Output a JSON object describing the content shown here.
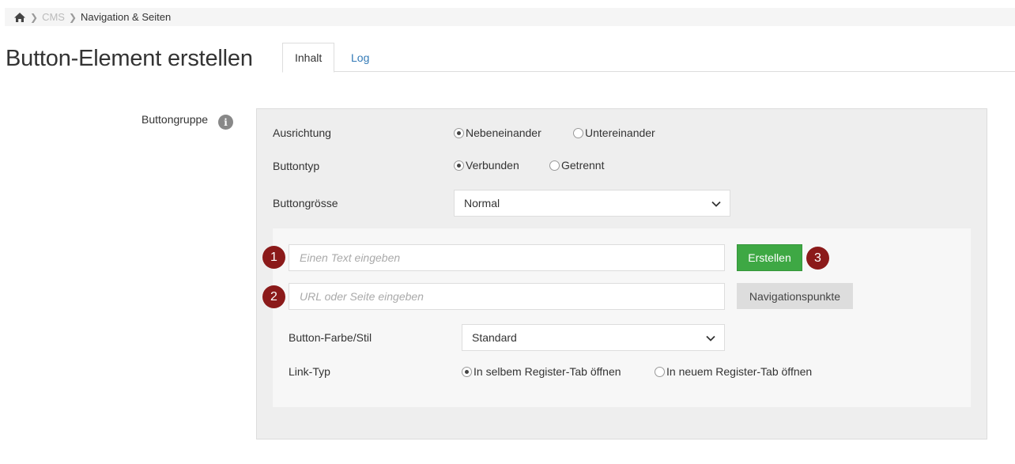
{
  "breadcrumb": {
    "home_icon": "home-icon",
    "items": [
      "CMS",
      "Navigation & Seiten"
    ]
  },
  "page": {
    "title": "Button-Element erstellen"
  },
  "tabs": [
    {
      "label": "Inhalt",
      "active": true
    },
    {
      "label": "Log",
      "active": false
    }
  ],
  "group": {
    "label": "Buttongruppe",
    "info_icon": "info-icon"
  },
  "ausrichtung": {
    "label": "Ausrichtung",
    "options": [
      "Nebeneinander",
      "Untereinander"
    ],
    "selected": "Nebeneinander"
  },
  "buttontyp": {
    "label": "Buttontyp",
    "options": [
      "Verbunden",
      "Getrennt"
    ],
    "selected": "Verbunden"
  },
  "buttongroesse": {
    "label": "Buttongrösse",
    "value": "Normal"
  },
  "button_editor": {
    "text_placeholder": "Einen Text eingeben",
    "url_placeholder": "URL oder Seite eingeben",
    "create_label": "Erstellen",
    "nav_label": "Navigationspunkte",
    "markers": [
      "1",
      "2",
      "3"
    ],
    "color_label": "Button-Farbe/Stil",
    "color_value": "Standard",
    "linktyp_label": "Link-Typ",
    "linktyp_options": [
      "In selbem Register-Tab öffnen",
      "In neuem Register-Tab öffnen"
    ],
    "linktyp_selected": "In selbem Register-Tab öffnen"
  },
  "colors": {
    "create_button": "#3ea844",
    "marker": "#8b1a1a",
    "link": "#337ab7"
  }
}
